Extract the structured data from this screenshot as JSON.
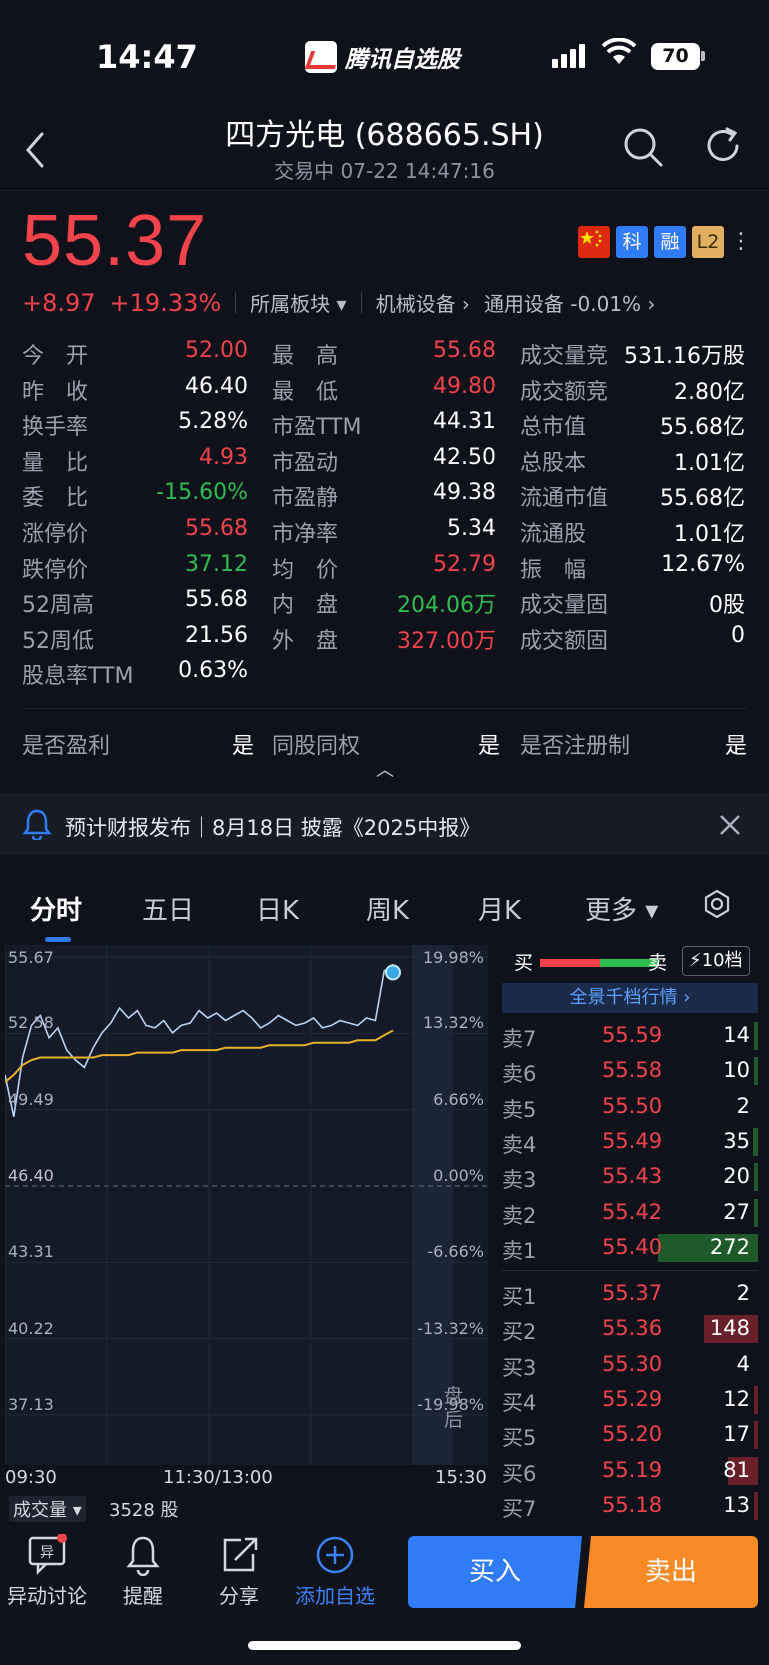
{
  "status_bar": {
    "time": "14:47",
    "app_name": "腾讯自选股",
    "battery": "70"
  },
  "header": {
    "title": "四方光电 (688665.SH)",
    "subtitle": "交易中    07-22 14:47:16"
  },
  "price": {
    "last": "55.37",
    "change": "+8.97",
    "change_pct": "+19.33%",
    "sector_label": "所属板块",
    "sector1": "机械设备",
    "sector2": "通用设备 -0.01%",
    "badges": [
      "科",
      "融",
      "L2"
    ]
  },
  "quote": {
    "col1": [
      {
        "label": "今　开",
        "value": "52.00",
        "color": "#f0434b"
      },
      {
        "label": "昨　收",
        "value": "46.40",
        "color": "#ffffff"
      },
      {
        "label": "换手率",
        "value": "5.28%",
        "color": "#ffffff"
      },
      {
        "label": "量　比",
        "value": "4.93",
        "color": "#f0434b"
      },
      {
        "label": "委　比",
        "value": "-15.60%",
        "color": "#2fbd4f"
      },
      {
        "label": "涨停价",
        "value": "55.68",
        "color": "#f0434b"
      },
      {
        "label": "跌停价",
        "value": "37.12",
        "color": "#2fbd4f"
      },
      {
        "label": "52周高",
        "value": "55.68",
        "color": "#ffffff"
      },
      {
        "label": "52周低",
        "value": "21.56",
        "color": "#ffffff"
      },
      {
        "label": "股息率TTM",
        "value": "0.63%",
        "color": "#ffffff"
      }
    ],
    "col2": [
      {
        "label": "最　高",
        "value": "55.68",
        "color": "#f0434b"
      },
      {
        "label": "最　低",
        "value": "49.80",
        "color": "#f0434b"
      },
      {
        "label": "市盈TTM",
        "value": "44.31",
        "color": "#ffffff"
      },
      {
        "label": "市盈动",
        "value": "42.50",
        "color": "#ffffff"
      },
      {
        "label": "市盈静",
        "value": "49.38",
        "color": "#ffffff"
      },
      {
        "label": "市净率",
        "value": "5.34",
        "color": "#ffffff"
      },
      {
        "label": "均　价",
        "value": "52.79",
        "color": "#f0434b"
      },
      {
        "label": "内　盘",
        "value": "204.06万",
        "color": "#2fbd4f"
      },
      {
        "label": "外　盘",
        "value": "327.00万",
        "color": "#f0434b"
      }
    ],
    "col3": [
      {
        "label": "成交量竞",
        "value": "531.16万股",
        "color": "#ffffff"
      },
      {
        "label": "成交额竞",
        "value": "2.80亿",
        "color": "#ffffff"
      },
      {
        "label": "总市值",
        "value": "55.68亿",
        "color": "#ffffff"
      },
      {
        "label": "总股本",
        "value": "1.01亿",
        "color": "#ffffff"
      },
      {
        "label": "流通市值",
        "value": "55.68亿",
        "color": "#ffffff"
      },
      {
        "label": "流通股",
        "value": "1.01亿",
        "color": "#ffffff"
      },
      {
        "label": "振　幅",
        "value": "12.67%",
        "color": "#ffffff"
      },
      {
        "label": "成交量固",
        "value": "0股",
        "color": "#ffffff"
      },
      {
        "label": "成交额固",
        "value": "0",
        "color": "#ffffff"
      }
    ],
    "flags": [
      {
        "label": "是否盈利",
        "value": "是"
      },
      {
        "label": "同股同权",
        "value": "是"
      },
      {
        "label": "是否注册制",
        "value": "是"
      }
    ]
  },
  "notice": {
    "text": "预计财报发布｜8月18日 披露《2025中报》"
  },
  "tabs": [
    "分时",
    "五日",
    "日K",
    "周K",
    "月K",
    "更多"
  ],
  "chart_data": {
    "type": "line",
    "title": "",
    "y_left_labels": [
      "55.67",
      "52.58",
      "49.49",
      "46.40",
      "43.31",
      "40.22",
      "37.13"
    ],
    "y_right_labels": [
      "19.98%",
      "13.32%",
      "6.66%",
      "0.00%",
      "-6.66%",
      "-13.32%",
      "-19.98%"
    ],
    "x_labels": [
      "09:30",
      "11:30/13:00",
      "15:30"
    ],
    "ylim": [
      37.13,
      55.67
    ],
    "prev_close": 46.4,
    "after_hours_label": "盘后",
    "series": [
      {
        "values": [
          50.9,
          49.2,
          51.6,
          52.9,
          53.3,
          52.4,
          52.8,
          51.9,
          51.5,
          51.2,
          52.0,
          52.6,
          53.0,
          53.6,
          53.2,
          53.5,
          52.9,
          52.8,
          53.1,
          52.6,
          52.9,
          53.0,
          53.5,
          53.2,
          53.4,
          53.1,
          53.3,
          53.5,
          53.2,
          52.8,
          53.0,
          53.3,
          53.1,
          52.9,
          53.0,
          53.2,
          52.8,
          52.9,
          53.1,
          53.0,
          52.9,
          53.2,
          53.1,
          55.1,
          55.37
        ],
        "color": "#b9d4f3"
      },
      {
        "values": [
          50.6,
          50.9,
          51.3,
          51.5,
          51.6,
          51.6,
          51.6,
          51.6,
          51.6,
          51.6,
          51.6,
          51.7,
          51.7,
          51.7,
          51.7,
          51.8,
          51.8,
          51.8,
          51.8,
          51.8,
          51.9,
          51.9,
          51.9,
          51.9,
          51.9,
          52.0,
          52.0,
          52.0,
          52.0,
          52.0,
          52.1,
          52.1,
          52.1,
          52.1,
          52.1,
          52.2,
          52.2,
          52.2,
          52.2,
          52.2,
          52.3,
          52.3,
          52.3,
          52.5,
          52.7
        ],
        "color": "#e8b12a"
      }
    ]
  },
  "volume": {
    "label": "成交量",
    "value": "3528 股"
  },
  "orderbook": {
    "buy_label": "买",
    "sell_label": "卖",
    "depth_label": "10档",
    "panorama": "全景千档行情",
    "asks": [
      {
        "label": "卖7",
        "price": "55.59",
        "vol": "14",
        "bar": 0.02
      },
      {
        "label": "卖6",
        "price": "55.58",
        "vol": "10",
        "bar": 0.02
      },
      {
        "label": "卖5",
        "price": "55.50",
        "vol": "2",
        "bar": 0.0
      },
      {
        "label": "卖4",
        "price": "55.49",
        "vol": "35",
        "bar": 0.05
      },
      {
        "label": "卖3",
        "price": "55.43",
        "vol": "20",
        "bar": 0.03
      },
      {
        "label": "卖2",
        "price": "55.42",
        "vol": "27",
        "bar": 0.04
      },
      {
        "label": "卖1",
        "price": "55.40",
        "vol": "272",
        "bar": 1.0
      }
    ],
    "bids": [
      {
        "label": "买1",
        "price": "55.37",
        "vol": "2",
        "bar": 0.0
      },
      {
        "label": "买2",
        "price": "55.36",
        "vol": "148",
        "bar": 0.54
      },
      {
        "label": "买3",
        "price": "55.30",
        "vol": "4",
        "bar": 0.0
      },
      {
        "label": "买4",
        "price": "55.29",
        "vol": "12",
        "bar": 0.02
      },
      {
        "label": "买5",
        "price": "55.20",
        "vol": "17",
        "bar": 0.03
      },
      {
        "label": "买6",
        "price": "55.19",
        "vol": "81",
        "bar": 0.3
      },
      {
        "label": "买7",
        "price": "55.18",
        "vol": "13",
        "bar": 0.02
      }
    ]
  },
  "bottom_nav": {
    "discuss": "异动讨论",
    "alert": "提醒",
    "share": "分享",
    "add_watch": "添加自选",
    "buy": "买入",
    "sell": "卖出"
  }
}
